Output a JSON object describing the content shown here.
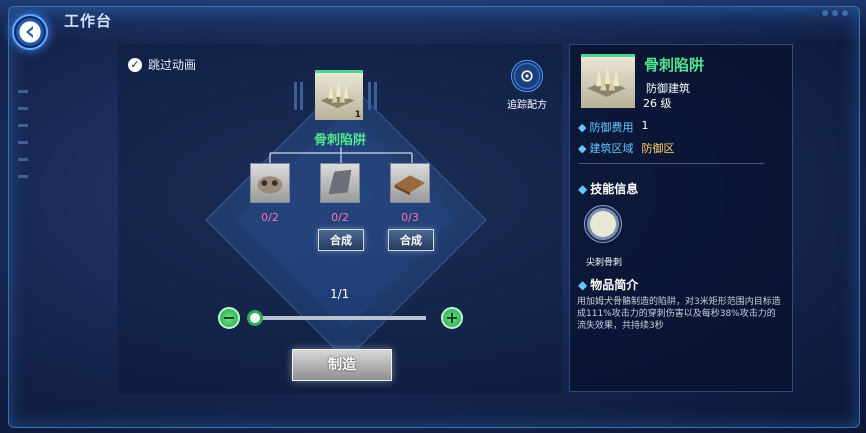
{
  "header": {
    "title": "工作台"
  },
  "left": {
    "skip_animation_label": "跳过动画",
    "target_item": {
      "name": "骨刺陷阱",
      "count": "1"
    },
    "materials": [
      {
        "icon": "bone-material-icon",
        "count": "0/2",
        "has_synth": false
      },
      {
        "icon": "stone-shard-icon",
        "count": "0/2",
        "has_synth": true
      },
      {
        "icon": "wood-plank-icon",
        "count": "0/3",
        "has_synth": true
      }
    ],
    "synth_label": "合成",
    "track_recipe_label": "追踪配方",
    "quantity": "1/1",
    "slider_value": 0,
    "make_label": "制造"
  },
  "detail": {
    "name": "骨刺陷阱",
    "type": "防御建筑",
    "level": "26 级",
    "stats": [
      {
        "label": "防御费用",
        "value": "1",
        "highlight": false
      },
      {
        "label": "建筑区域",
        "value": "防御区",
        "highlight": true
      }
    ],
    "skills_title": "技能信息",
    "skill_name": "尖刺骨刺",
    "description_title": "物品简介",
    "description": "用加姆犬骨骼制造的陷阱，对3米矩形范围内目标造成111%攻击力的穿刺伤害以及每秒38%攻击力的流失效果，共持续3秒"
  },
  "colors": {
    "item_green": "#53e38f",
    "count_pink": "#ff6fb0",
    "accent_blue": "#66c6ff",
    "area_yellow": "#ffd36b"
  }
}
